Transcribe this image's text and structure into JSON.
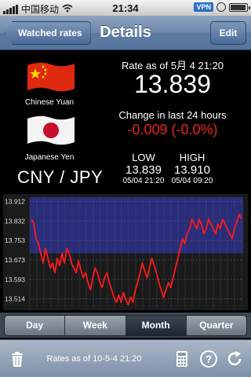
{
  "status_bar": {
    "carrier": "中国移动",
    "time": "21:34",
    "vpn": "VPN"
  },
  "nav": {
    "back_label": "Watched rates",
    "title": "Details",
    "edit_label": "Edit"
  },
  "currencies": {
    "base_name": "Chinese Yuan",
    "quote_name": "Japanese Yen",
    "pair": "CNY / JPY"
  },
  "rate": {
    "label": "Rate as of 5月 4 21:20",
    "value": "13.839"
  },
  "change": {
    "label": "Change in last 24 hours",
    "value": "-0.009 (-0.0%)",
    "color": "#e8241f"
  },
  "low": {
    "label": "LOW",
    "value": "13.839",
    "time": "05/04 21:20"
  },
  "high": {
    "label": "HIGH",
    "value": "13.910",
    "time": "05/04 09:20"
  },
  "segments": [
    "Day",
    "Week",
    "Month",
    "Quarter"
  ],
  "active_segment": "Month",
  "toolbar": {
    "status": "Rates as of 10-5-4 21:20",
    "icons": [
      "trash-icon",
      "calculator-icon",
      "help-icon",
      "refresh-icon"
    ]
  },
  "chart_data": {
    "type": "line",
    "y_ticks": [
      "13.912",
      "13.832",
      "13.753",
      "13.673",
      "13.593",
      "13.514"
    ],
    "ylim": [
      13.48,
      13.93
    ],
    "series": [
      {
        "color": "#ff1a1a",
        "values": [
          13.84,
          13.82,
          13.76,
          13.74,
          13.7,
          13.66,
          13.72,
          13.68,
          13.64,
          13.66,
          13.62,
          13.68,
          13.65,
          13.7,
          13.66,
          13.72,
          13.7,
          13.66,
          13.64,
          13.62,
          13.67,
          13.63,
          13.6,
          13.62,
          13.58,
          13.55,
          13.6,
          13.64,
          13.62,
          13.58,
          13.56,
          13.6,
          13.62,
          13.58,
          13.55,
          13.52,
          13.5,
          13.53,
          13.5,
          13.54,
          13.51,
          13.49,
          13.52,
          13.5,
          13.55,
          13.58,
          13.62,
          13.66,
          13.63,
          13.6,
          13.64,
          13.68,
          13.65,
          13.62,
          13.58,
          13.55,
          13.52,
          13.55,
          13.58,
          13.56,
          13.6,
          13.64,
          13.68,
          13.72,
          13.76,
          13.74,
          13.78,
          13.8,
          13.84,
          13.82,
          13.8,
          13.84,
          13.82,
          13.78,
          13.8,
          13.84,
          13.82,
          13.8,
          13.78,
          13.82,
          13.8,
          13.84,
          13.82,
          13.8,
          13.78,
          13.76,
          13.8,
          13.83,
          13.86,
          13.84
        ]
      }
    ],
    "colors": {
      "plot_bg_upper": "#2c2f8a",
      "plot_bg_lower": "#1a1a1a",
      "grid": "#5a5a7a"
    }
  }
}
